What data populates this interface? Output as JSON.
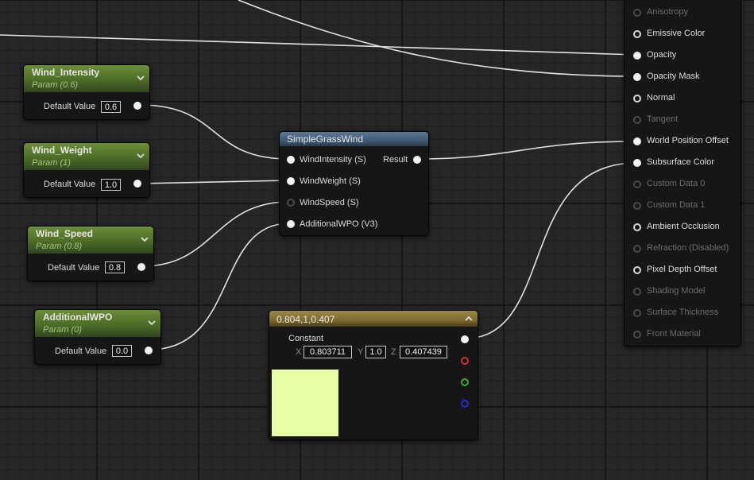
{
  "params": [
    {
      "title": "Wind_Intensity",
      "subtitle": "Param (0.6)",
      "field_label": "Default Value",
      "value": "0.6"
    },
    {
      "title": "Wind_Weight",
      "subtitle": "Param (1)",
      "field_label": "Default Value",
      "value": "1.0"
    },
    {
      "title": "Wind_Speed",
      "subtitle": "Param (0.8)",
      "field_label": "Default Value",
      "value": "0.8"
    },
    {
      "title": "AdditionalWPO",
      "subtitle": "Param (0)",
      "field_label": "Default Value",
      "value": "0.0"
    }
  ],
  "function_node": {
    "title": "SimpleGrassWind",
    "inputs": [
      "WindIntensity (S)",
      "WindWeight (S)",
      "WindSpeed (S)",
      "AdditionalWPO (V3)"
    ],
    "output": "Result"
  },
  "constant_node": {
    "title": "0.804,1,0.407",
    "label": "Constant",
    "x_label": "X",
    "x": "0.803711",
    "y_label": "Y",
    "y": "1.0",
    "z_label": "Z",
    "z": "0.407439",
    "swatch_color": "#e8ffa6"
  },
  "result_pins": [
    {
      "label": "Anisotropy",
      "enabled": false,
      "connected": false
    },
    {
      "label": "Emissive Color",
      "enabled": true,
      "connected": false
    },
    {
      "label": "Opacity",
      "enabled": true,
      "connected": true
    },
    {
      "label": "Opacity Mask",
      "enabled": true,
      "connected": true
    },
    {
      "label": "Normal",
      "enabled": true,
      "connected": false
    },
    {
      "label": "Tangent",
      "enabled": false,
      "connected": false
    },
    {
      "label": "World Position Offset",
      "enabled": true,
      "connected": true
    },
    {
      "label": "Subsurface Color",
      "enabled": true,
      "connected": true
    },
    {
      "label": "Custom Data 0",
      "enabled": false,
      "connected": false
    },
    {
      "label": "Custom Data 1",
      "enabled": false,
      "connected": false
    },
    {
      "label": "Ambient Occlusion",
      "enabled": true,
      "connected": false
    },
    {
      "label": "Refraction (Disabled)",
      "enabled": false,
      "connected": false
    },
    {
      "label": "Pixel Depth Offset",
      "enabled": true,
      "connected": false
    },
    {
      "label": "Shading Model",
      "enabled": false,
      "connected": false
    },
    {
      "label": "Surface Thickness",
      "enabled": false,
      "connected": false
    },
    {
      "label": "Front Material",
      "enabled": false,
      "connected": false
    }
  ],
  "colors": {
    "param_header": "#5c7d30",
    "function_header": "#4a6680",
    "constant_header": "#8a7838",
    "wire": "#e0e0e0"
  }
}
